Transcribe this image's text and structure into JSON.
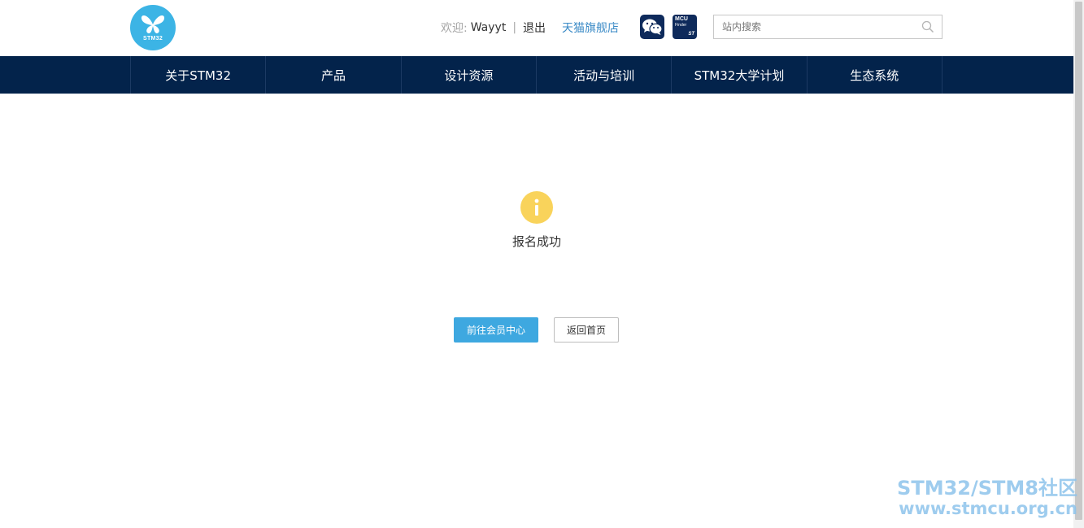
{
  "header": {
    "logo_text": "STM32",
    "welcome_label": "欢迎:",
    "username": "Wayyt",
    "separator": "|",
    "logout_label": "退出",
    "tmall_label": "天猫旗舰店",
    "wechat_icon": "wechat-icon",
    "mcu_finder": {
      "line1": "MCU",
      "line2": "Finder",
      "brand": "ST"
    },
    "search": {
      "placeholder": "站内搜索",
      "value": ""
    }
  },
  "nav": {
    "items": [
      {
        "label": "关于STM32"
      },
      {
        "label": "产品"
      },
      {
        "label": "设计资源"
      },
      {
        "label": "活动与培训"
      },
      {
        "label": "STM32大学计划"
      },
      {
        "label": "生态系统"
      }
    ]
  },
  "main": {
    "status_icon": "info-icon",
    "status_text": "报名成功",
    "primary_button": "前往会员中心",
    "secondary_button": "返回首页"
  },
  "watermark": {
    "line1": "STM32/STM8社区",
    "line2": "www.stmcu.org.cn"
  },
  "colors": {
    "nav_bg": "#03234b",
    "accent": "#3ea8e0",
    "logo": "#3cb4e5",
    "info_icon": "#f9d35b"
  }
}
